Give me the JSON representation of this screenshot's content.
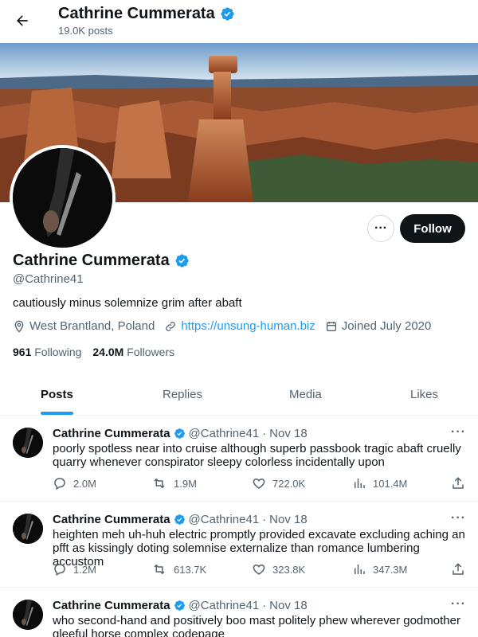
{
  "header": {
    "name": "Cathrine Cummerata",
    "post_count": "19.0K posts"
  },
  "profile": {
    "name": "Cathrine Cummerata",
    "handle": "@Cathrine41",
    "bio": "cautiously minus solemnize grim after abaft",
    "location": "West Brantland, Poland",
    "website": "https://unsung-human.biz",
    "joined": "Joined July 2020",
    "following_count": "961",
    "following_label": "Following",
    "followers_count": "24.0M",
    "followers_label": "Followers",
    "follow_label": "Follow",
    "more_label": "···"
  },
  "tabs": [
    {
      "label": "Posts",
      "active": true
    },
    {
      "label": "Replies",
      "active": false
    },
    {
      "label": "Media",
      "active": false
    },
    {
      "label": "Likes",
      "active": false
    }
  ],
  "posts": [
    {
      "name": "Cathrine Cummerata",
      "handle": "@Cathrine41",
      "sep": "·",
      "date": "Nov 18",
      "text": "poorly spotless near into cruise although superb passbook tragic abaft cruelly quarry whenever conspirator sleepy colorless incidentally upon",
      "replies": "2.0M",
      "reposts": "1.9M",
      "likes": "722.0K",
      "views": "101.4M"
    },
    {
      "name": "Cathrine Cummerata",
      "handle": "@Cathrine41",
      "sep": "·",
      "date": "Nov 18",
      "text": "heighten meh uh-huh electric promptly provided excavate excluding aching an pfft as kissingly doting solemnise externalize than romance lumbering accustom",
      "replies": "1.2M",
      "reposts": "613.7K",
      "likes": "323.8K",
      "views": "347.3M"
    },
    {
      "name": "Cathrine Cummerata",
      "handle": "@Cathrine41",
      "sep": "·",
      "date": "Nov 18",
      "text": "who second-hand and positively boo mast politely phew wherever godmother gleeful horse complex codepage",
      "replies": "",
      "reposts": "",
      "likes": "",
      "views": ""
    }
  ],
  "icons": {
    "back": "arrow-left-icon",
    "verified": "verified-badge-icon",
    "location": "location-pin-icon",
    "link": "link-icon",
    "calendar": "calendar-icon",
    "reply": "reply-icon",
    "repost": "repost-icon",
    "like": "heart-icon",
    "views": "views-bar-icon",
    "share": "share-icon"
  },
  "colors": {
    "accent": "#1d9bf0",
    "text": "#0f1419",
    "muted": "#536471",
    "button": "#0f1419"
  }
}
